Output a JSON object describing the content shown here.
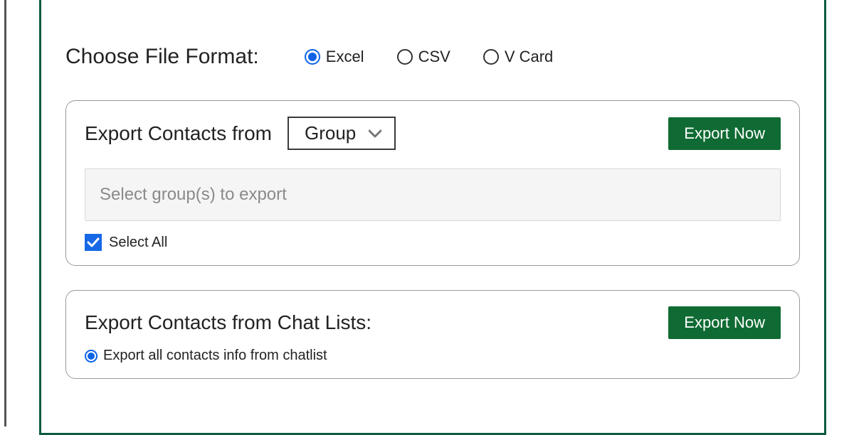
{
  "format": {
    "label": "Choose File Format:",
    "options": {
      "excel": "Excel",
      "csv": "CSV",
      "vcard": "V Card"
    },
    "selected": "excel"
  },
  "section_group": {
    "title": "Export Contacts from",
    "select_value": "Group",
    "input_placeholder": "Select group(s) to export",
    "select_all_label": "Select All",
    "select_all_checked": true,
    "export_button": "Export Now"
  },
  "section_chat": {
    "title": "Export Contacts from Chat Lists:",
    "option_label": "Export all contacts info from chatlist",
    "option_selected": true,
    "export_button": "Export Now"
  }
}
